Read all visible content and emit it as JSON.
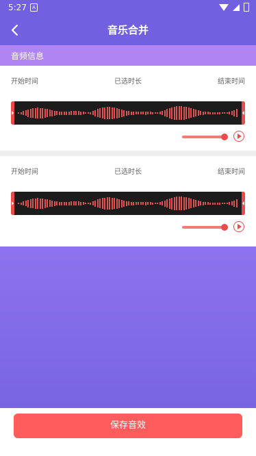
{
  "status_bar": {
    "time": "5:27",
    "notification_icon": "A"
  },
  "header": {
    "title": "音乐合并",
    "back_icon": "chevron-left-icon"
  },
  "section": {
    "title": "音频信息"
  },
  "tracks": [
    {
      "start_label": "开始时间",
      "selected_label": "已选时长",
      "end_label": "结束时间",
      "volume_level": 1.0
    },
    {
      "start_label": "开始时间",
      "selected_label": "已选时长",
      "end_label": "结束时间",
      "volume_level": 1.0
    }
  ],
  "save_button": {
    "label": "保存音效"
  },
  "colors": {
    "primary": "#7161E0",
    "section": "#AE85F3",
    "accent": "#FF5D5D",
    "wave_bar": "#E05353"
  }
}
